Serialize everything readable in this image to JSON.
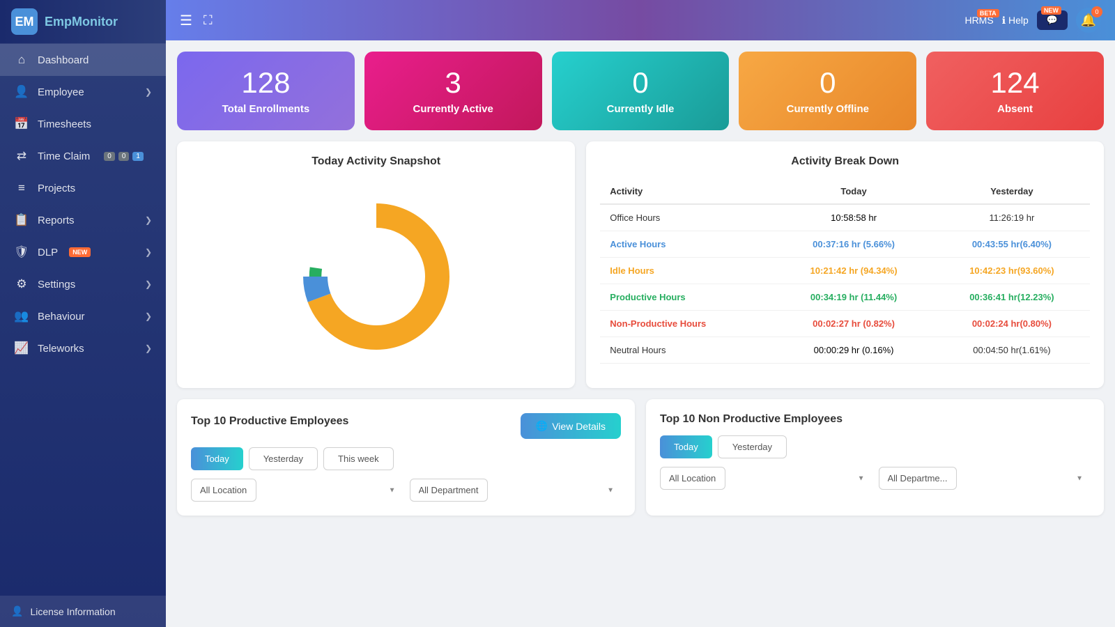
{
  "app": {
    "logo_main": "Emp",
    "logo_accent": "Monitor",
    "logo_icon": "EM"
  },
  "topbar": {
    "hrms_label": "HRMS",
    "hrms_badge": "BETA",
    "help_label": "Help",
    "new_btn": "NEW",
    "notif_count": "0"
  },
  "sidebar": {
    "items": [
      {
        "id": "dashboard",
        "label": "Dashboard",
        "icon": "⌂",
        "has_chevron": false
      },
      {
        "id": "employee",
        "label": "Employee",
        "icon": "👤",
        "has_chevron": true
      },
      {
        "id": "timesheets",
        "label": "Timesheets",
        "icon": "📅",
        "has_chevron": false
      },
      {
        "id": "time-claim",
        "label": "Time Claim",
        "icon": "⇄",
        "has_chevron": false,
        "badges": [
          "0",
          "0",
          "1"
        ]
      },
      {
        "id": "projects",
        "label": "Projects",
        "icon": "≡",
        "has_chevron": false
      },
      {
        "id": "reports",
        "label": "Reports",
        "icon": "📋",
        "has_chevron": true
      },
      {
        "id": "dlp",
        "label": "DLP",
        "icon": "⚙",
        "has_chevron": true,
        "new_badge": true
      },
      {
        "id": "settings",
        "label": "Settings",
        "icon": "⚙",
        "has_chevron": true
      },
      {
        "id": "behaviour",
        "label": "Behaviour",
        "icon": "👥",
        "has_chevron": true
      },
      {
        "id": "teleworks",
        "label": "Teleworks",
        "icon": "📈",
        "has_chevron": true
      }
    ],
    "footer": {
      "label": "License Information",
      "icon": "👤"
    }
  },
  "stat_cards": [
    {
      "id": "total-enrollments",
      "number": "128",
      "label": "Total Enrollments",
      "color_class": "card-purple"
    },
    {
      "id": "currently-active",
      "number": "3",
      "label": "Currently Active",
      "color_class": "card-pink"
    },
    {
      "id": "currently-idle",
      "number": "0",
      "label": "Currently Idle",
      "color_class": "card-teal"
    },
    {
      "id": "currently-offline",
      "number": "0",
      "label": "Currently Offline",
      "color_class": "card-orange"
    },
    {
      "id": "absent",
      "number": "124",
      "label": "Absent",
      "color_class": "card-red"
    }
  ],
  "activity_snapshot": {
    "title": "Today Activity Snapshot",
    "donut": {
      "segments": [
        {
          "label": "Idle Hours",
          "color": "#f5a623",
          "percent": 94.34
        },
        {
          "label": "Active Hours",
          "color": "#4a90d9",
          "percent": 5.66
        },
        {
          "label": "Productive Hours",
          "color": "#27ae60",
          "percent": 0.5
        }
      ]
    }
  },
  "activity_breakdown": {
    "title": "Activity Break Down",
    "columns": [
      "Activity",
      "Today",
      "Yesterday"
    ],
    "rows": [
      {
        "activity": "Office Hours",
        "today": "10:58:58 hr",
        "yesterday": "11:26:19 hr",
        "today_color": "default",
        "yesterday_color": "default"
      },
      {
        "activity": "Active Hours",
        "today": "00:37:16 hr (5.66%)",
        "yesterday": "00:43:55 hr(6.40%)",
        "today_color": "blue",
        "yesterday_color": "blue"
      },
      {
        "activity": "Idle Hours",
        "today": "10:21:42 hr (94.34%)",
        "yesterday": "10:42:23 hr(93.60%)",
        "today_color": "yellow",
        "yesterday_color": "yellow"
      },
      {
        "activity": "Productive Hours",
        "today": "00:34:19 hr (11.44%)",
        "yesterday": "00:36:41 hr(12.23%)",
        "today_color": "green",
        "yesterday_color": "green"
      },
      {
        "activity": "Non-Productive Hours",
        "today": "00:02:27 hr (0.82%)",
        "yesterday": "00:02:24 hr(0.80%)",
        "today_color": "red",
        "yesterday_color": "red"
      },
      {
        "activity": "Neutral Hours",
        "today": "00:00:29 hr (0.16%)",
        "yesterday": "00:04:50 hr(1.61%)",
        "today_color": "default",
        "yesterday_color": "default"
      }
    ]
  },
  "top_productive": {
    "title": "Top 10 Productive Employees",
    "view_details_label": "View Details",
    "tabs": [
      "Today",
      "Yesterday",
      "This week"
    ],
    "active_tab": "Today",
    "dropdowns": [
      "All Location",
      "All Department"
    ]
  },
  "top_non_productive": {
    "title": "Top 10 Non Productive Employees",
    "tabs": [
      "Today",
      "Yesterday"
    ],
    "active_tab": "Today",
    "dropdowns": [
      "All Location",
      "All Departme..."
    ]
  }
}
